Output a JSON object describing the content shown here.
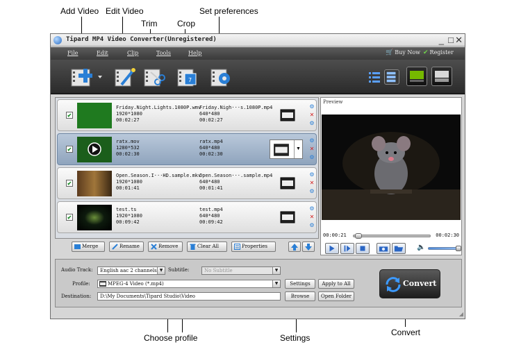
{
  "callouts": {
    "add_video": "Add Video",
    "edit_video": "Edit Video",
    "trim": "Trim",
    "crop": "Crop",
    "set_preferences": "Set preferences",
    "choose_profile": "Choose profile",
    "settings": "Settings",
    "convert": "Convert"
  },
  "window": {
    "title": "Tipard MP4 Video Converter(Unregistered)",
    "minimize": "_",
    "maximize": "□",
    "close": "✕"
  },
  "menu": {
    "items": [
      "File",
      "Edit",
      "Clip",
      "Tools",
      "Help"
    ],
    "buy_now": "Buy Now",
    "register": "Register"
  },
  "toolbar": {
    "tools": [
      "add-video",
      "edit-video",
      "trim",
      "crop",
      "preferences"
    ],
    "badges": [
      "NVIDIA",
      "AMD"
    ]
  },
  "files": [
    {
      "source_name": "Friday.Night.Lights.1080P.wmv",
      "source_res": "1920*1080",
      "source_dur": "00:02:27",
      "output_name": "Friday.Nigh···s.1080P.mp4",
      "output_res": "640*480",
      "output_dur": "00:02:27",
      "selected": false,
      "thumb_color": "#1f7a1f"
    },
    {
      "source_name": "ratx.mov",
      "source_res": "1280*532",
      "source_dur": "00:02:30",
      "output_name": "ratx.mp4",
      "output_res": "640*480",
      "output_dur": "00:02:30",
      "selected": true,
      "thumb_color": "#1b5e1b"
    },
    {
      "source_name": "Open.Season.I···HD.sample.mkv",
      "source_res": "1920*1080",
      "source_dur": "00:01:41",
      "output_name": "Open.Season···.sample.mp4",
      "output_res": "640*480",
      "output_dur": "00:01:41",
      "selected": false,
      "thumb_color": "#6b4a2a"
    },
    {
      "source_name": "test.ts",
      "source_res": "1920*1080",
      "source_dur": "00:09:42",
      "output_name": "test.mp4",
      "output_res": "640*480",
      "output_dur": "00:09:42",
      "selected": false,
      "thumb_color": "#0d1a0d"
    }
  ],
  "list_buttons": {
    "merge": "Merge",
    "rename": "Rename",
    "remove": "Remove",
    "clear_all": "Clear All",
    "properties": "Properties"
  },
  "preview": {
    "label": "Preview",
    "current_time": "00:00:21",
    "total_time": "00:02:30"
  },
  "settings": {
    "audio_track_label": "Audio Track:",
    "audio_track_value": "English aac 2 channels (0",
    "subtitle_label": "Subtitle:",
    "subtitle_value": "No Subtitle",
    "profile_label": "Profile:",
    "profile_value": "MPEG-4 Video (*.mp4)",
    "destination_label": "Destination:",
    "destination_value": "D:\\My Documents\\Tipard Studio\\Video",
    "settings_btn": "Settings",
    "apply_all_btn": "Apply to All",
    "browse_btn": "Browse",
    "open_folder_btn": "Open Folder",
    "convert_btn": "Convert"
  },
  "colors": {
    "toolbar_dark": "#2b2b2b",
    "accent_blue": "#2a7fd6",
    "check_green": "#1e8d2b",
    "remove_red": "#d42020"
  }
}
